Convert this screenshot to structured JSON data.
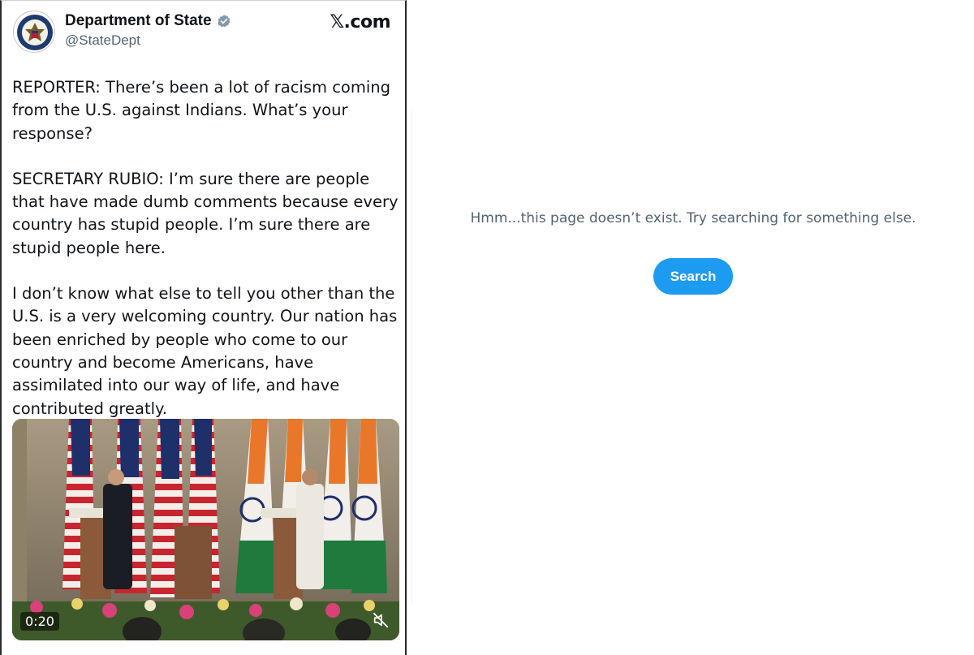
{
  "tweet": {
    "display_name": "Department of State",
    "handle": "@StateDept",
    "site_label": "𝕏.com",
    "paragraphs": [
      "REPORTER: There’s been a lot of racism coming from the U.S. against Indians. What’s your response?",
      "SECRETARY RUBIO: I’m sure there are people that have made dumb comments because every country has stupid people. I’m sure there are stupid people here.",
      "I don’t know what else to tell you other than the U.S. is a very welcoming country. Our nation has been enriched by people who come to our country and become Americans, have assimilated into our way of life, and have contributed greatly."
    ],
    "video": {
      "duration": "0:20",
      "icons": {
        "mute": "mute-icon",
        "verified": "verified-badge-icon"
      }
    }
  },
  "error_page": {
    "message": "Hmm...this page doesn’t exist. Try searching for something else.",
    "search_button_label": "Search"
  },
  "colors": {
    "accent": "#1d9bf0",
    "text_primary": "#0f1419",
    "text_secondary": "#536471"
  }
}
